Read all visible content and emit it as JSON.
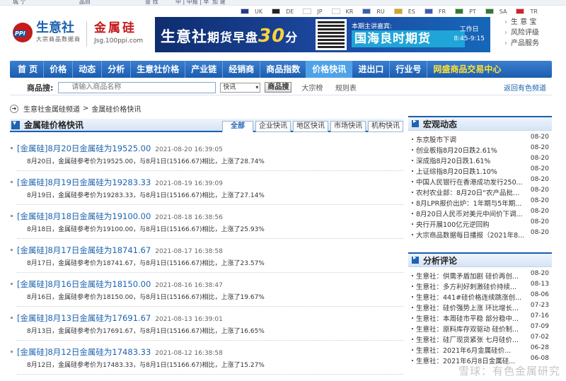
{
  "top_strip": {
    "a": "城 亇",
    "b": "品目",
    "c": "查 找",
    "d": "中 | 中报 | 早",
    "e": "加 速"
  },
  "languages": [
    {
      "code": "UK",
      "color": "#1f3b8a"
    },
    {
      "code": "DE",
      "color": "#222222"
    },
    {
      "code": "JP",
      "color": "#ffffff"
    },
    {
      "code": "KR",
      "color": "#ffffff"
    },
    {
      "code": "RU",
      "color": "#3b5fb0"
    },
    {
      "code": "ES",
      "color": "#d8a21a"
    },
    {
      "code": "FR",
      "color": "#3d5bb3"
    },
    {
      "code": "PT",
      "color": "#2f7a2f"
    },
    {
      "code": "SA",
      "color": "#2f7a2f"
    },
    {
      "code": "TR",
      "color": "#d81f26"
    }
  ],
  "logo": {
    "name": "生意社",
    "sub": "大宗商品数据商"
  },
  "channel": {
    "name": "金属硅",
    "url": "Jsg.100ppi.com"
  },
  "banner": {
    "title_a": "生意社",
    "title_b": "期货早盘",
    "number": "30",
    "title_c": "分",
    "host": "本期主讲嘉宾:",
    "firm": "国海良时期货",
    "day": "工作日",
    "time": "8:45-9:15"
  },
  "quick_links": [
    "生 意 宝",
    "风险评级",
    "产品服务"
  ],
  "nav": [
    "首 页",
    "价格",
    "动态",
    "分析",
    "生意社价格",
    "产业链",
    "经销商",
    "商品指数",
    "价格快讯",
    "进出口",
    "行业号",
    "网盛商品交易中心"
  ],
  "nav_active": "价格快讯",
  "search": {
    "label": "商品搜:",
    "placeholder": "请输入商品名称",
    "select": "快讯",
    "button": "商品搜",
    "links": [
      "大宗榜",
      "规则表"
    ],
    "back": "返回有色频道"
  },
  "breadcrumb": {
    "a": "生意社金属硅频道",
    "sep": ">",
    "b": "金属硅价格快讯"
  },
  "left": {
    "title": "金属硅价格快讯",
    "tabs": [
      "全部",
      "企业快讯",
      "地区快讯",
      "市场快讯",
      "机构快讯"
    ],
    "entries": [
      {
        "h": "[金属硅]8月20日金属硅为19525.00",
        "d": "2021-08-20 16:39:05",
        "b": "8月20日，金属硅参考价为19525.00，与8月1日(15166.67)相比，上涨了28.74%"
      },
      {
        "h": "[金属硅]8月19日金属硅为19283.33",
        "d": "2021-08-19 16:39:09",
        "b": "8月19日，金属硅参考价为19283.33，与8月1日(15166.67)相比，上涨了27.14%"
      },
      {
        "h": "[金属硅]8月18日金属硅为19100.00",
        "d": "2021-08-18 16:38:56",
        "b": "8月18日，金属硅参考价为19100.00，与8月1日(15166.67)相比，上涨了25.93%"
      },
      {
        "h": "[金属硅]8月17日金属硅为18741.67",
        "d": "2021-08-17 16:38:58",
        "b": "8月17日，金属硅参考价为18741.67，与8月1日(15166.67)相比，上涨了23.57%"
      },
      {
        "h": "[金属硅]8月16日金属硅为18150.00",
        "d": "2021-08-16 16:38:47",
        "b": "8月16日，金属硅参考价为18150.00，与8月1日(15166.67)相比，上涨了19.67%"
      },
      {
        "h": "[金属硅]8月13日金属硅为17691.67",
        "d": "2021-08-13 16:39:01",
        "b": "8月13日，金属硅参考价为17691.67，与8月1日(15166.67)相比，上涨了16.65%"
      },
      {
        "h": "[金属硅]8月12日金属硅为17483.33",
        "d": "2021-08-12 16:38:58",
        "b": "8月12日，金属硅参考价为17483.33，与8月1日(15166.67)相比，上涨了15.27%"
      }
    ]
  },
  "macro": {
    "title": "宏观动态",
    "items": [
      {
        "t": "东京股市下调",
        "d": "08-20"
      },
      {
        "t": "创业板指8月20日跌2.61%",
        "d": "08-20"
      },
      {
        "t": "深成指8月20日跌1.61%",
        "d": "08-20"
      },
      {
        "t": "上证综指8月20日跌1.10%",
        "d": "08-20"
      },
      {
        "t": "中国人民银行在香港成功发行250...",
        "d": "08-20"
      },
      {
        "t": "农村农业部：8月20日“农产品批...",
        "d": "08-20"
      },
      {
        "t": "8月LPR报价出炉：1年期与5年期...",
        "d": "08-20"
      },
      {
        "t": "8月20日人民币对美元中间价下调...",
        "d": "08-20"
      },
      {
        "t": "央行开展100亿元逆回购",
        "d": "08-20"
      },
      {
        "t": "大宗商品数据每日播报（2021年8...",
        "d": "08-20"
      }
    ]
  },
  "analysis": {
    "title": "分析评论",
    "items": [
      {
        "t": "生意社：供需矛盾加剧 硅价再创...",
        "d": "08-20"
      },
      {
        "t": "生意社：多方利好刺激硅价持续...",
        "d": "08-13"
      },
      {
        "t": "生意社：441#硅价格连续跳涨创...",
        "d": "08-06"
      },
      {
        "t": "生意社：硅价强势上涨 环比增长...",
        "d": "07-23"
      },
      {
        "t": "生意社：本周硅市平稳 部分稳中...",
        "d": "07-16"
      },
      {
        "t": "生意社：原料库存双驱动 硅价制...",
        "d": "07-09"
      },
      {
        "t": "生意社：硅厂现货紧张 七月硅价...",
        "d": "07-02"
      },
      {
        "t": "生意社：2021年6月金属硅价...",
        "d": "06-28"
      },
      {
        "t": "生意社：2021年6月8日金属硅...",
        "d": "06-08"
      }
    ]
  },
  "watermark": "雪球：有色金属研究"
}
